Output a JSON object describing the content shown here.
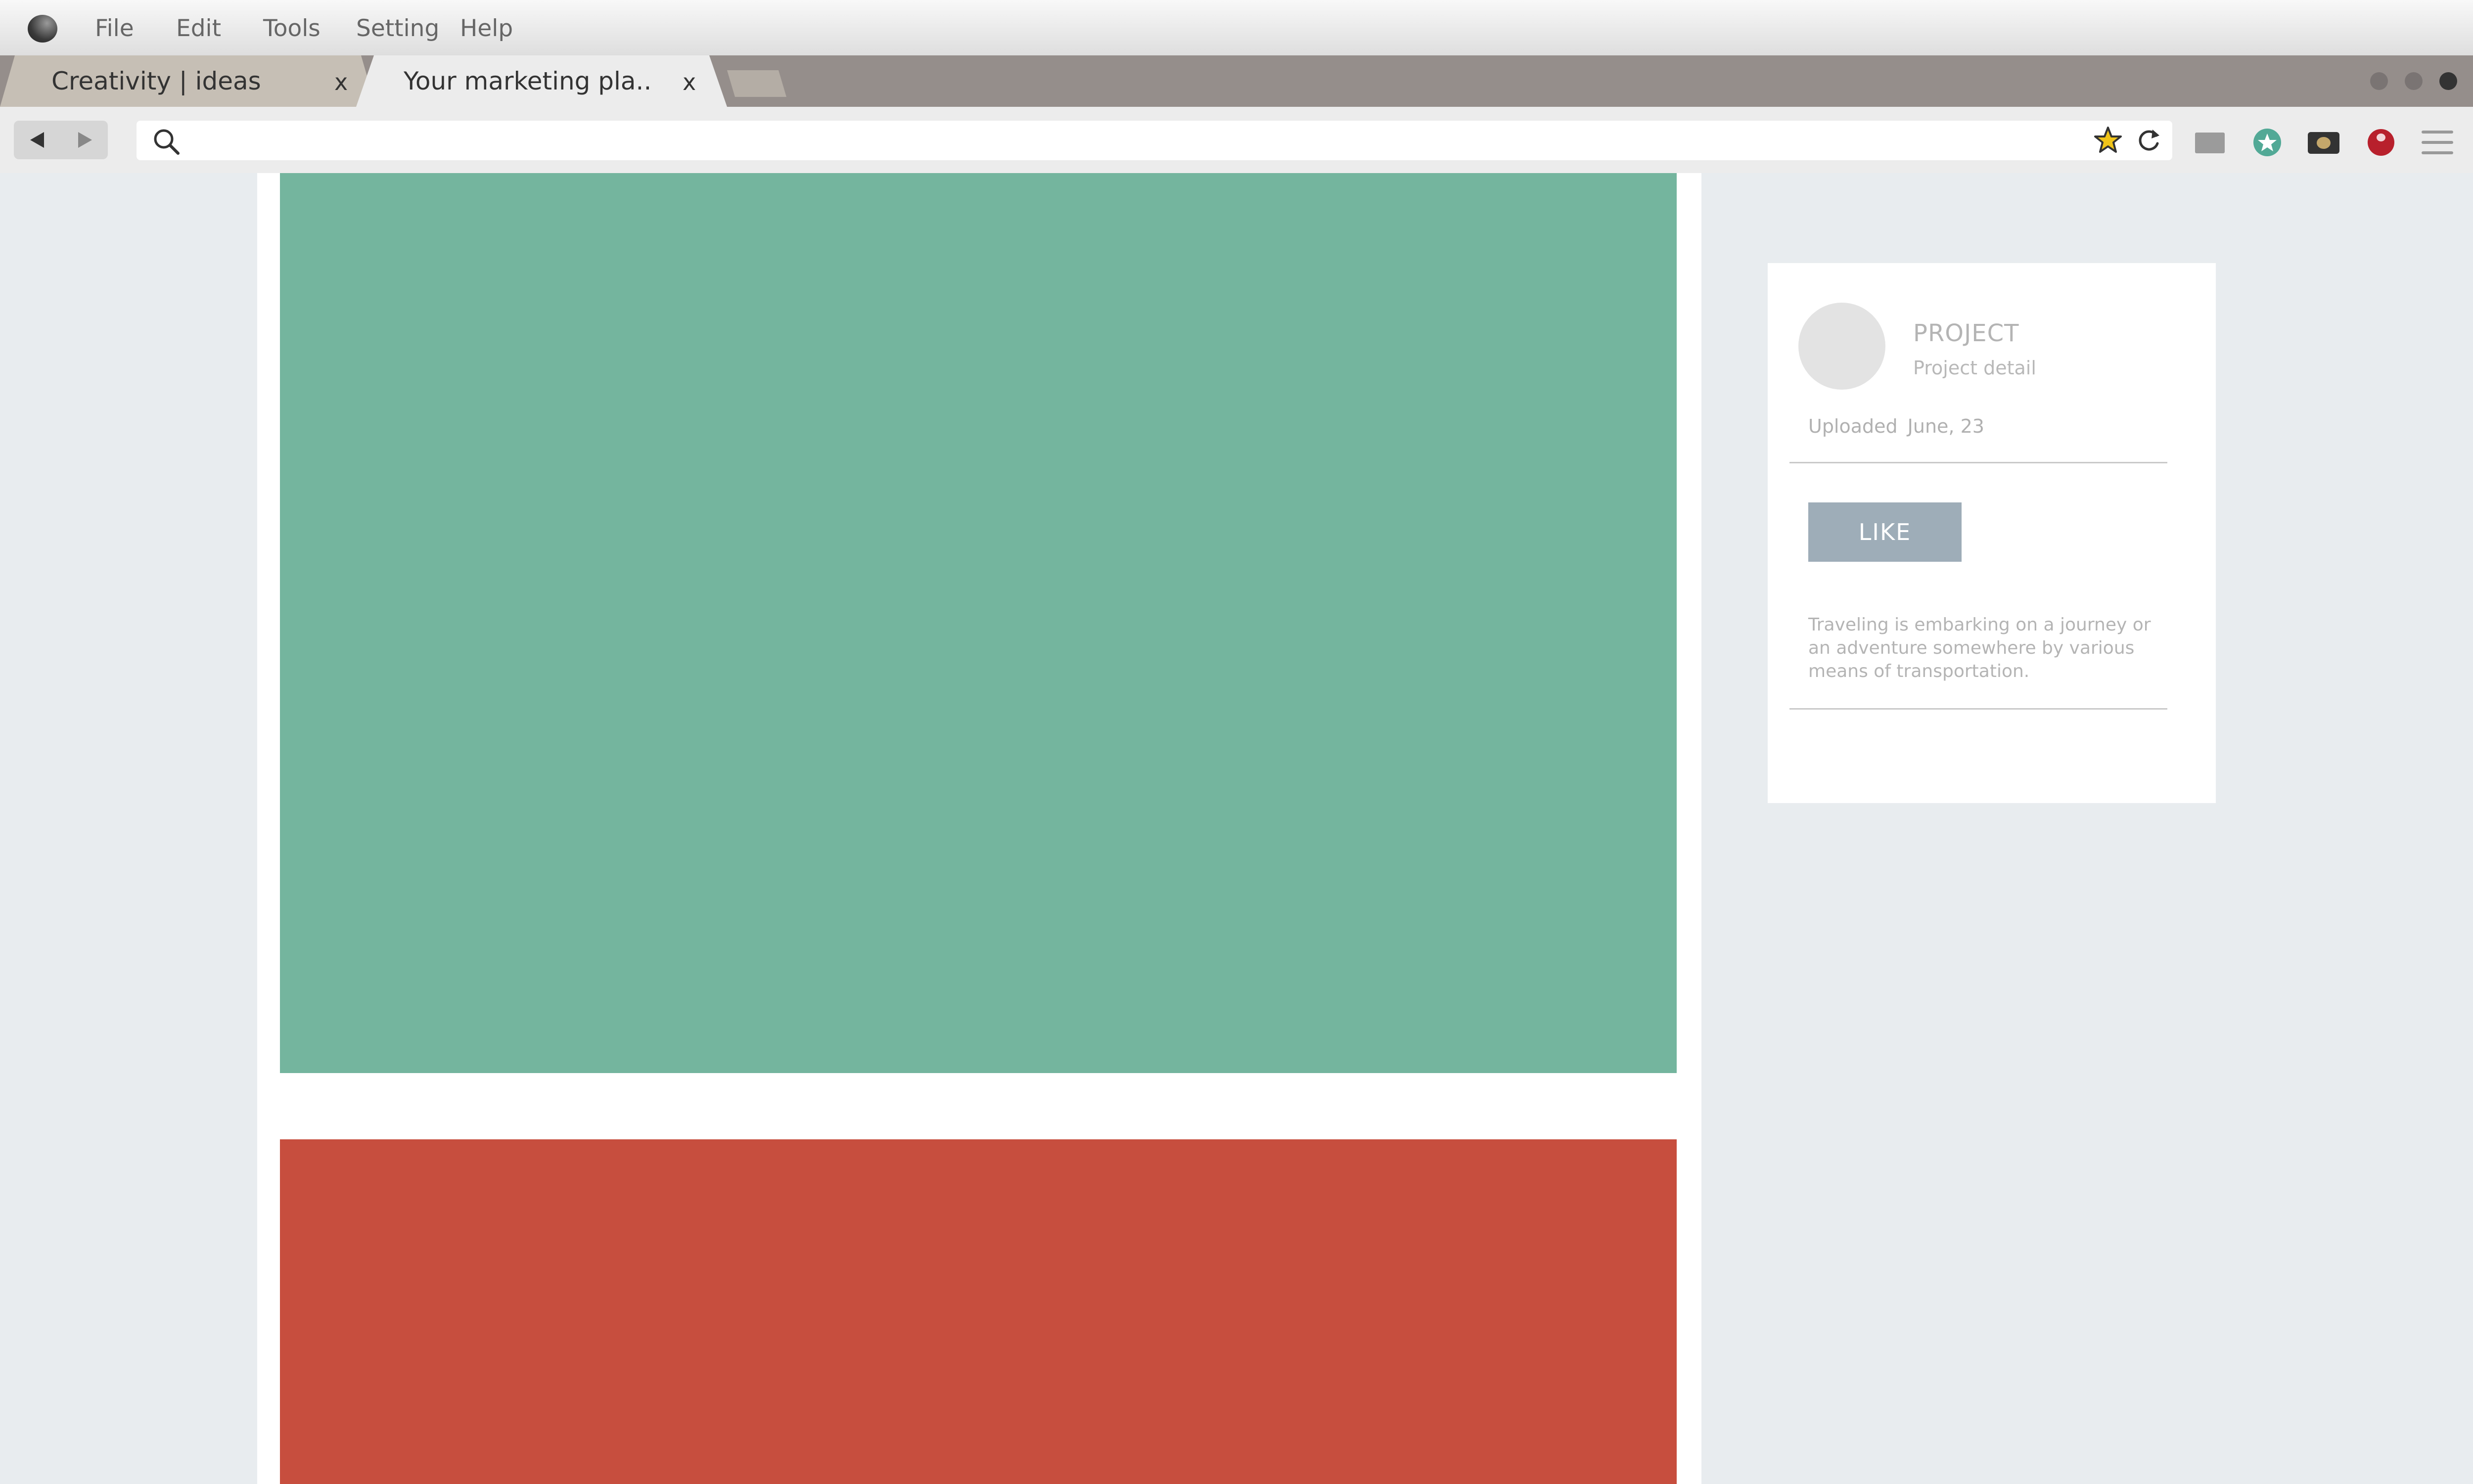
{
  "menubar": {
    "items": [
      "File",
      "Edit",
      "Tools",
      "Setting",
      "Help"
    ]
  },
  "tabs": [
    {
      "label": "Creativity  |  ideas",
      "close": "x"
    },
    {
      "label": "Your marketing pla..",
      "close": "x"
    }
  ],
  "toolbar": {
    "url_value": "",
    "icons": [
      "back-arrow-icon",
      "forward-arrow-icon",
      "search-icon",
      "star-icon",
      "reload-icon"
    ]
  },
  "extensions": [
    "folder-icon",
    "star-badge-icon",
    "camera-icon",
    "red-circle-icon",
    "hamburger-menu-icon"
  ],
  "content": {
    "media_colors": [
      "#74b59e",
      "#c74e3e"
    ]
  },
  "card": {
    "title": "PROJECT",
    "subtitle": "Project detail",
    "uploaded_label": "Uploaded",
    "uploaded_date": "June, 23",
    "like_label": "LIKE",
    "description": "Traveling is embarking on a journey or an adventure somewhere by various means of transportation."
  },
  "colors": {
    "accent": "#9eadb8",
    "tab_bar": "#958e8b",
    "page_bg": "#e8ecef"
  }
}
